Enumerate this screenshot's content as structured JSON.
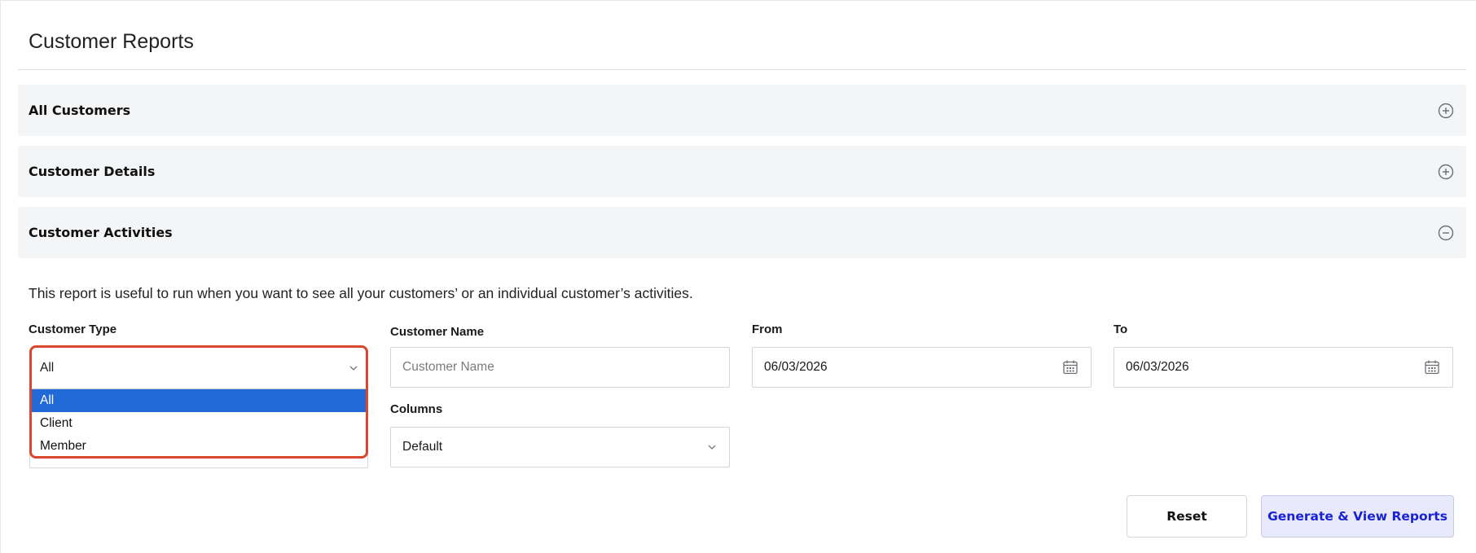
{
  "page": {
    "title": "Customer Reports"
  },
  "accordions": [
    {
      "label": "All Customers",
      "icon": "plus-circle-icon",
      "expanded": false
    },
    {
      "label": "Customer Details",
      "icon": "plus-circle-icon",
      "expanded": false
    },
    {
      "label": "Customer Activities",
      "icon": "minus-circle-icon",
      "expanded": true
    }
  ],
  "activities": {
    "description": "This report is useful to run when you want to see all your customers’ or an individual customer’s activities.",
    "customer_type": {
      "label": "Customer Type",
      "value": "All",
      "options": [
        "All",
        "Client",
        "Member"
      ],
      "selected_option": "All"
    },
    "customer_name": {
      "label": "Customer Name",
      "value": "",
      "placeholder": "Customer Name"
    },
    "from": {
      "label": "From",
      "value": "06/03/2026"
    },
    "to": {
      "label": "To",
      "value": "06/03/2026"
    },
    "columns": {
      "label": "Columns",
      "value": "Default"
    }
  },
  "actions": {
    "reset_label": "Reset",
    "generate_label": "Generate & View Reports"
  },
  "colors": {
    "accent_blue": "#1f6ad6",
    "highlight_border": "#d9472f",
    "generate_text": "#1a22d6",
    "generate_bg": "#e8e9fb"
  }
}
